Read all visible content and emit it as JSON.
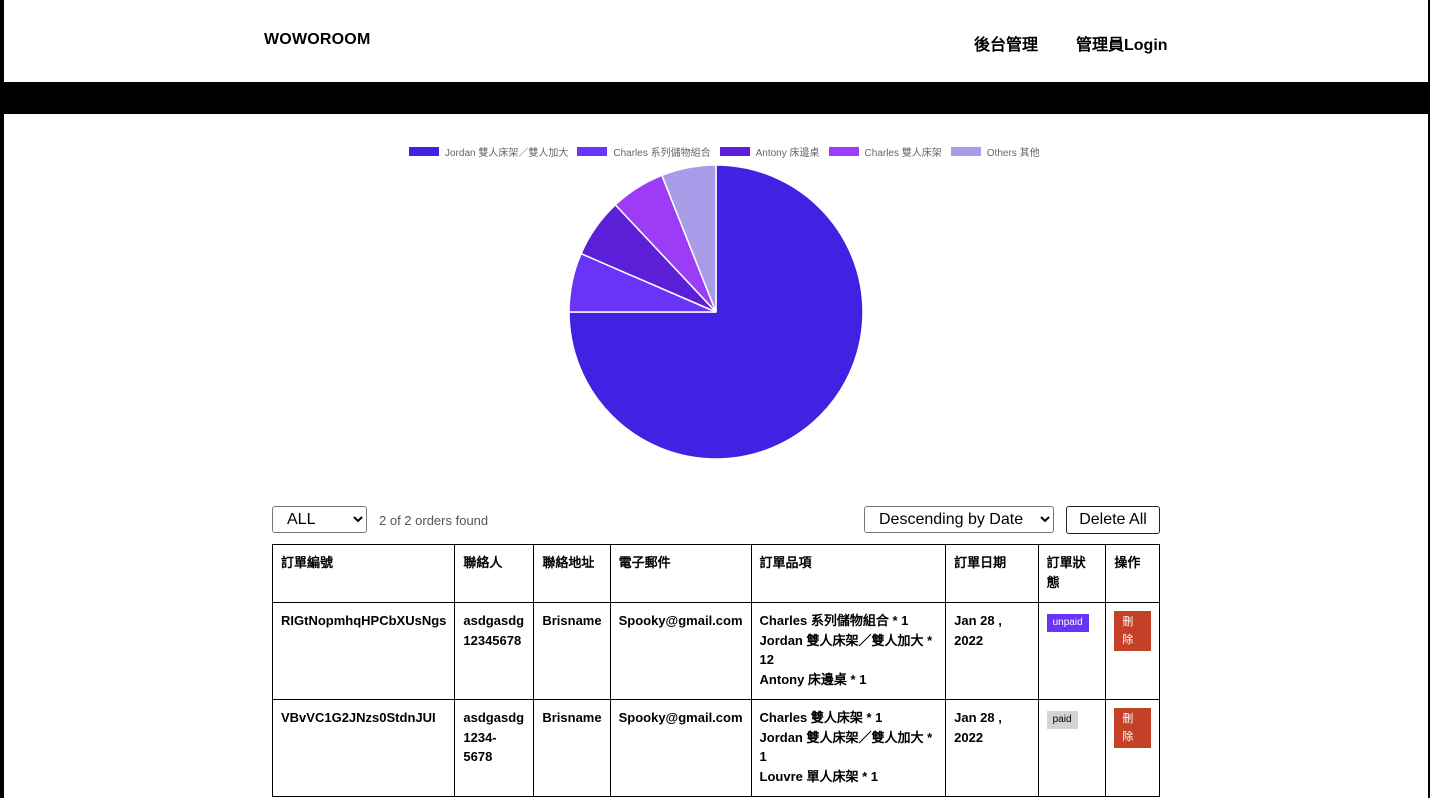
{
  "header": {
    "logo": "WOWOROOM",
    "nav": {
      "backend": "後台管理",
      "login": "管理員Login"
    }
  },
  "chart_data": {
    "type": "pie",
    "categories": [
      "Jordan 雙人床架／雙人加大",
      "Charles 系列儲物組合",
      "Antony 床邊桌",
      "Charles 雙人床架",
      "Others 其他"
    ],
    "values": [
      75,
      6.5,
      6.5,
      6,
      6
    ],
    "colors": [
      "#4221e2",
      "#6a33f8",
      "#5a1fd6",
      "#9d3cf7",
      "#a89be7"
    ],
    "legend": "top",
    "title": ""
  },
  "controls": {
    "filter_options": [
      "ALL"
    ],
    "filter_selected": "ALL",
    "orders_found": "2 of 2 orders found",
    "sort_options": [
      "Descending by Date"
    ],
    "sort_selected": "Descending by Date",
    "delete_all": "Delete All"
  },
  "table": {
    "headers": [
      "訂單編號",
      "聯絡人",
      "聯絡地址",
      "電子郵件",
      "訂單品項",
      "訂單日期",
      "訂單狀態",
      "操作"
    ],
    "rows": [
      {
        "id": "RIGtNopmhqHPCbXUsNgs",
        "contact": "asdgasdg 12345678",
        "address": "Brisname",
        "email": "Spooky@gmail.com",
        "items": [
          "Charles 系列儲物組合 * 1",
          "Jordan 雙人床架／雙人加大 * 12",
          "Antony 床邊桌 * 1"
        ],
        "date": "Jan 28 , 2022",
        "status": "unpaid",
        "action": "刪除"
      },
      {
        "id": "VBvVC1G2JNzs0StdnJUI",
        "contact": "asdgasdg 1234-5678",
        "address": "Brisname",
        "email": "Spooky@gmail.com",
        "items": [
          "Charles 雙人床架 * 1",
          "Jordan 雙人床架／雙人加大 * 1",
          "Louvre 單人床架 * 1"
        ],
        "date": "Jan 28 , 2022",
        "status": "paid",
        "action": "刪除"
      }
    ]
  }
}
